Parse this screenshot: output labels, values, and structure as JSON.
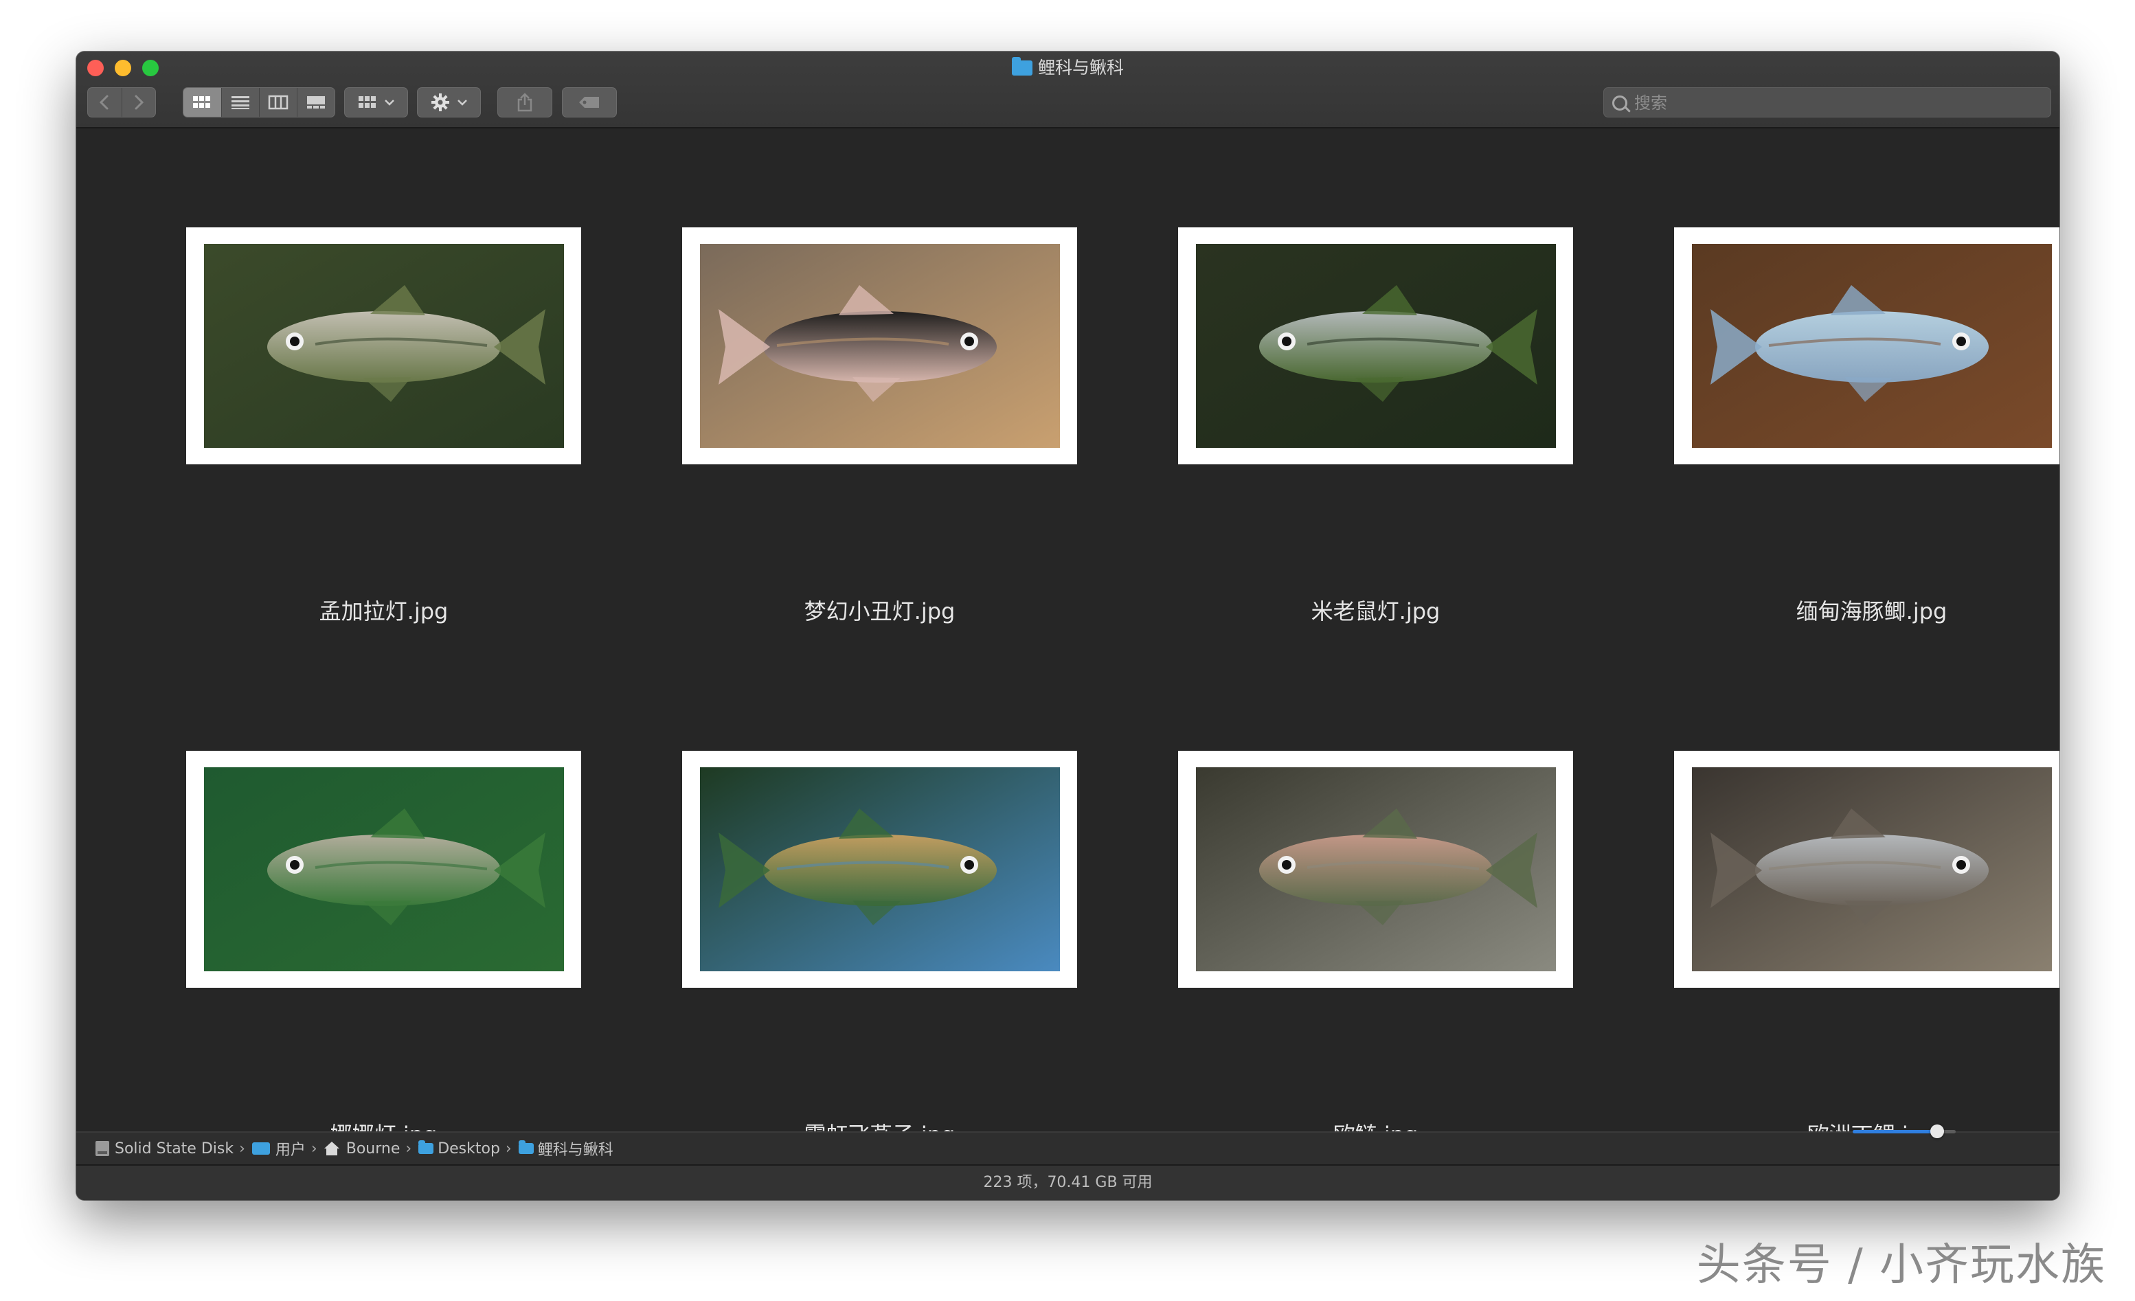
{
  "window": {
    "title": "鲤科与鳅科"
  },
  "toolbar": {
    "back_icon": "chevron-left-icon",
    "forward_icon": "chevron-right-icon",
    "view_modes": [
      "icon-view",
      "list-view",
      "column-view",
      "gallery-view"
    ],
    "active_view": "icon-view",
    "group_icon": "grid-icon",
    "action_icon": "gear-icon",
    "share_icon": "share-icon",
    "tag_icon": "tag-icon"
  },
  "search": {
    "placeholder": "搜索",
    "value": ""
  },
  "files": [
    {
      "name": "孟加拉灯.jpg",
      "palette": [
        "#3b4a2a",
        "#6b7a4a",
        "#c9c4b8",
        "#2a3a22"
      ]
    },
    {
      "name": "梦幻小丑灯.jpg",
      "palette": [
        "#7a6a5a",
        "#d9b8b0",
        "#1a1a1a",
        "#c9a070"
      ]
    },
    {
      "name": "米老鼠灯.jpg",
      "palette": [
        "#2a3320",
        "#4a6a30",
        "#b9bfc0",
        "#1e2a1a"
      ]
    },
    {
      "name": "缅甸海豚鲫.jpg",
      "palette": [
        "#5a3a22",
        "#8aaac8",
        "#b8d6e8",
        "#7a4a2a"
      ]
    },
    {
      "name": "娜娜灯.jpg",
      "palette": [
        "#1f5a30",
        "#3a7a3a",
        "#b8b0a0",
        "#2a6a32"
      ]
    },
    {
      "name": "霓虹飞燕子.jpg",
      "palette": [
        "#1e3a22",
        "#3a6a3a",
        "#c8a060",
        "#4a8ac0"
      ]
    },
    {
      "name": "欧鲢.jpg",
      "palette": [
        "#3a3a30",
        "#5a6a4a",
        "#c89a8a",
        "#8a8a80"
      ]
    },
    {
      "name": "欧洲丁鲤.jpg",
      "palette": [
        "#3a3530",
        "#6a6258",
        "#b8bcc0",
        "#8a8070"
      ]
    }
  ],
  "pathbar": {
    "crumbs": [
      "Solid State Disk",
      "用户",
      "Bourne",
      "Desktop",
      "鲤科与鳅科"
    ],
    "separator": "›"
  },
  "status": {
    "text": "223 项，70.41 GB 可用"
  },
  "icon_size_slider": {
    "value": 0.82
  },
  "watermark": {
    "text": "头条号 / 小齐玩水族"
  }
}
